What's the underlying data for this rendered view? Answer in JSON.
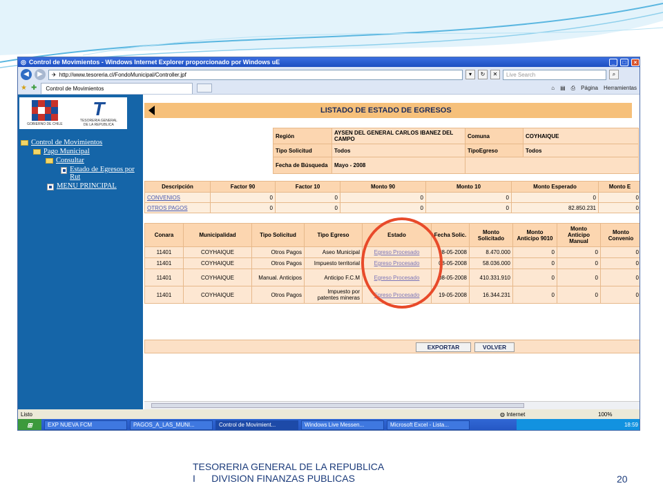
{
  "browser": {
    "window_title": "Control de Movimientos - Windows Internet Explorer proporcionado por Windows uE",
    "address": "http://www.tesoreria.cl/FondoMunicipal/Controller.jpf",
    "search_placeholder": "Live Search",
    "tab_title": "Control de Movimientos",
    "cmd_page": "Página",
    "cmd_tools": "Herramientas",
    "status": "Listo",
    "zone": "Internet",
    "zoom": "100%"
  },
  "sidebar": {
    "logo_left": "GOBIERNO DE CHILE",
    "logo_right": "TESORERIA GENERAL DE LA REPUBLICA",
    "menu": {
      "control": "Control de Movimientos",
      "pago": "Pago Municipal",
      "consultar": "Consultar",
      "estado": "Estado de Egresos por Rut",
      "principal": "MENU PRINCIPAL"
    }
  },
  "page": {
    "title": "LISTADO DE ESTADO DE EGRESOS",
    "filters": {
      "region_label": "Región",
      "region_value": "AYSEN DEL GENERAL CARLOS IBANEZ DEL CAMPO",
      "comuna_label": "Comuna",
      "comuna_value": "COYHAIQUE",
      "tipo_solicitud_label": "Tipo Solicitud",
      "tipo_solicitud_value": "Todos",
      "tipo_egreso_label": "TipoEgreso",
      "tipo_egreso_value": "Todos",
      "fecha_label": "Fecha de Búsqueda",
      "fecha_value": "Mayo - 2008"
    },
    "summary": {
      "headers": [
        "Descripción",
        "Factor 90",
        "Factor 10",
        "Monto 90",
        "Monto 10",
        "Monto Esperado",
        "Monto E"
      ],
      "rows": [
        [
          "CONVENIOS",
          "0",
          "0",
          "0",
          "0",
          "0",
          "0"
        ],
        [
          "OTROS PAGOS",
          "0",
          "0",
          "0",
          "0",
          "82.850.231",
          "0"
        ]
      ]
    },
    "detail": {
      "headers": [
        "Conara",
        "Municipalidad",
        "Tipo Solicitud",
        "Tipo Egreso",
        "Estado",
        "Fecha Solic.",
        "Monto Solicitado",
        "Monto Anticipo 9010",
        "Monto Anticipo Manual",
        "Monto Convenio"
      ],
      "rows": [
        [
          "11401",
          "COYHAIQUE",
          "Otros Pagos",
          "Aseo Municipal",
          "Egreso Procesado",
          "08-05-2008",
          "8.470.000",
          "0",
          "0",
          "0"
        ],
        [
          "11401",
          "COYHAIQUE",
          "Otros Pagos",
          "Impuesto territorial",
          "Egreso Procesado",
          "08-05-2008",
          "58.036.000",
          "0",
          "0",
          "0"
        ],
        [
          "11401",
          "COYHAIQUE",
          "Manual. Anticipos",
          "Anticipo F.C.M",
          "Egreso Procesado",
          "08-05-2008",
          "410.331.910",
          "0",
          "0",
          "0"
        ],
        [
          "11401",
          "COYHAIQUE",
          "Otros Pagos",
          "Impuesto por patentes mineras",
          "Egreso Procesado",
          "19-05-2008",
          "16.344.231",
          "0",
          "0",
          "0"
        ]
      ]
    },
    "buttons": {
      "export": "EXPORTAR",
      "back": "VOLVER"
    }
  },
  "taskbar": {
    "items": [
      "EXP NUEVA FCM",
      "PAGOS_A_LAS_MUNI...",
      "Control de Movimient...",
      "Windows Live Messen...",
      "Microsoft Excel - Lista..."
    ],
    "clock": "18:59"
  },
  "slide": {
    "footer_line1": "TESORERIA GENERAL DE LA REPUBLICA",
    "footer_line2": "I      DIVISION FINANZAS PUBLICAS",
    "page_number": "20"
  }
}
